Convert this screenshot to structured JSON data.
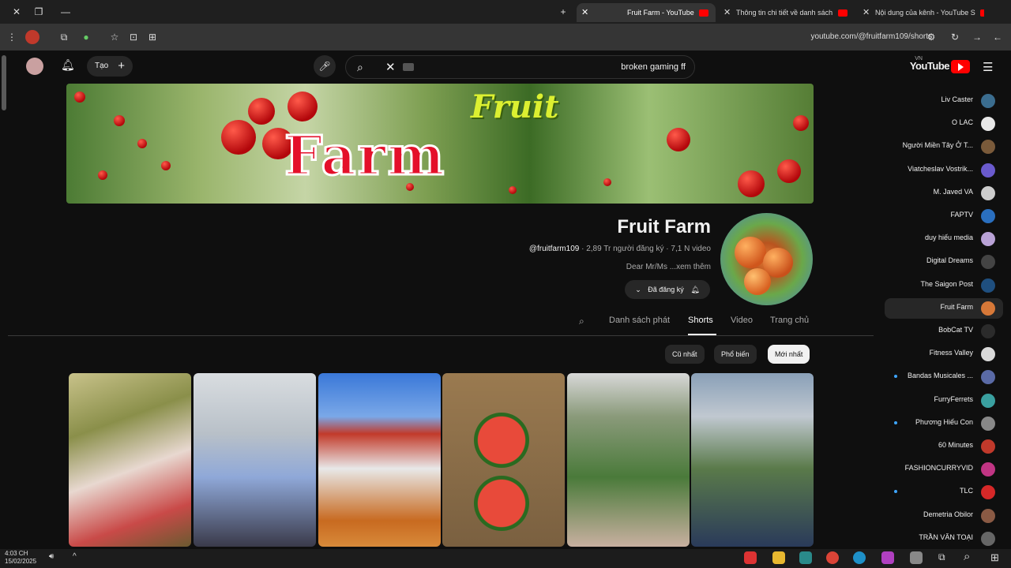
{
  "browser": {
    "tabs": [
      {
        "title": "Nội dung của kênh - YouTube S",
        "active": false
      },
      {
        "title": "Thông tin chi tiết về danh sách",
        "active": false
      },
      {
        "title": "Fruit Farm - YouTube",
        "active": true
      }
    ],
    "new_tab": "+",
    "url": "youtube.com/@fruitfarm109/shorts"
  },
  "youtube": {
    "logo_text": "YouTube",
    "region": "VN",
    "search_value": "broken gaming ff",
    "create_label": "Tạo",
    "create_icon": "+"
  },
  "channel": {
    "name": "Fruit Farm",
    "handle": "@fruitfarm109",
    "stats": " · 2,89 Tr người đăng ký · 7,1 N video",
    "description": "Dear Mr/Ms ...xem thêm",
    "subscribe_label": "Đã đăng ký",
    "banner_word1": "Fruit",
    "banner_word2": "Farm"
  },
  "tabs": [
    {
      "label": "Trang chủ",
      "active": false
    },
    {
      "label": "Video",
      "active": false
    },
    {
      "label": "Shorts",
      "active": true
    },
    {
      "label": "Danh sách phát",
      "active": false
    }
  ],
  "chips": [
    {
      "label": "Mới nhất",
      "selected": true
    },
    {
      "label": "Phổ biến",
      "selected": false
    },
    {
      "label": "Cũ nhất",
      "selected": false
    }
  ],
  "shorts": [
    {
      "theme": "fruit-cut"
    },
    {
      "theme": "woman-bag"
    },
    {
      "theme": "rooftop"
    },
    {
      "theme": "watermelon"
    },
    {
      "theme": "radish"
    },
    {
      "theme": "cactus"
    }
  ],
  "sidebar": [
    {
      "label": "Liv Caster",
      "color": "#3b6d8f",
      "dot": false
    },
    {
      "label": "O LAC",
      "color": "#e8e8e8",
      "dot": false
    },
    {
      "label": "Người Miền Tây Ở T...",
      "color": "#7a5a3a",
      "dot": false
    },
    {
      "label": "Viatcheslav Vostrik...",
      "color": "#6a5acd",
      "dot": false
    },
    {
      "label": "M. Javed VA",
      "color": "#cccccc",
      "dot": false
    },
    {
      "label": "FAPTV",
      "color": "#2a6fbf",
      "dot": false
    },
    {
      "label": "duy hiếu media",
      "color": "#b9a2d6",
      "dot": false
    },
    {
      "label": "Digital Dreams",
      "color": "#444444",
      "dot": false
    },
    {
      "label": "The Saigon Post",
      "color": "#1f4f7f",
      "dot": false
    },
    {
      "label": "Fruit Farm",
      "color": "#d67838",
      "dot": false,
      "active": true
    },
    {
      "label": "BobCat TV",
      "color": "#2b2b2b",
      "dot": false
    },
    {
      "label": "Fitness Valley",
      "color": "#d9d9d9",
      "dot": false
    },
    {
      "label": "Bandas Musicales ...",
      "color": "#5a6aa6",
      "dot": true
    },
    {
      "label": "FurryFerrets",
      "color": "#3aa0a0",
      "dot": false
    },
    {
      "label": "Phương Hiếu Con",
      "color": "#888888",
      "dot": true
    },
    {
      "label": "60 Minutes",
      "color": "#c0392b",
      "dot": false
    },
    {
      "label": "FASHIONCURRYVID",
      "color": "#c13584",
      "dot": false
    },
    {
      "label": "TLC",
      "color": "#d62828",
      "dot": true
    },
    {
      "label": "Demetria Obilor",
      "color": "#8a5a44",
      "dot": false
    },
    {
      "label": "TRẦN VĂN TOẠI",
      "color": "#666666",
      "dot": false
    }
  ],
  "taskbar": {
    "time": "4:03 CH",
    "date": "15/02/2025"
  }
}
